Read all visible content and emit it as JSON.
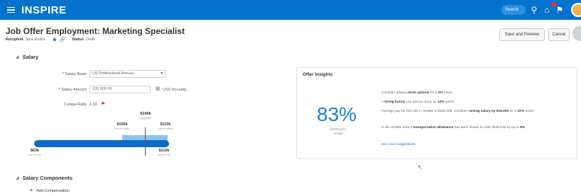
{
  "topbar": {
    "brand": "INSPIRE",
    "search_placeholder": "Search"
  },
  "page": {
    "title": "Job Offer Employment: Marketing Specialist",
    "recipient_label": "Recipient",
    "recipient_value": "Sara Evans",
    "status_label": "Status",
    "status_value": "Draft",
    "save_preview": "Save and Preview",
    "cancel": "Cancel"
  },
  "salary": {
    "section_title": "Salary",
    "basis_label": "Salary Basis",
    "basis_value": "US Professional Annual",
    "amount_label": "Salary Amount",
    "amount_value": "105,000.00",
    "amount_unit": "USD Annually",
    "ratio_label": "Compa-Ratio",
    "ratio_value": "1.12",
    "range": {
      "min_val": "$63k",
      "min_cap": "min for role",
      "max_val": "$110k",
      "max_cap": "max for role",
      "mid_val": "$106k",
      "mid_cap": "min by region",
      "sug_val": "$108k",
      "sug_cap": "suggestion",
      "top_val": "$110k",
      "top_cap": "max for region"
    }
  },
  "insights": {
    "title": "Offer Insights",
    "percent": "83%",
    "percent_label": "Likelihood to Accept",
    "tips": [
      {
        "pre": "Consider adding ",
        "bold": "stock options",
        "mid": " for a ",
        "bold2": "2%",
        "post": " boost"
      },
      {
        "pre": "A ",
        "bold": "hiring bonus",
        "mid": " can add as many as ",
        "bold2": "12%",
        "post": " points"
      },
      {
        "pre": "Average pay for this role in Seattle is $120,000. Consider ",
        "bold": "raising salary by $15,000",
        "mid": " for a ",
        "bold2": "15%",
        "post": " boost"
      },
      {
        "pre": "In the Seattle area a ",
        "bold": "transportation allowance",
        "mid": " has been shown to raise likeliness by up to ",
        "bold2": "8%",
        "post": ""
      }
    ],
    "more_link": "See more suggestions"
  },
  "components": {
    "section_title": "Salary Components",
    "add_label": "Add Compensation"
  },
  "colors": {
    "brand_blue": "#0572ce",
    "percent_blue": "#1a84d4"
  }
}
